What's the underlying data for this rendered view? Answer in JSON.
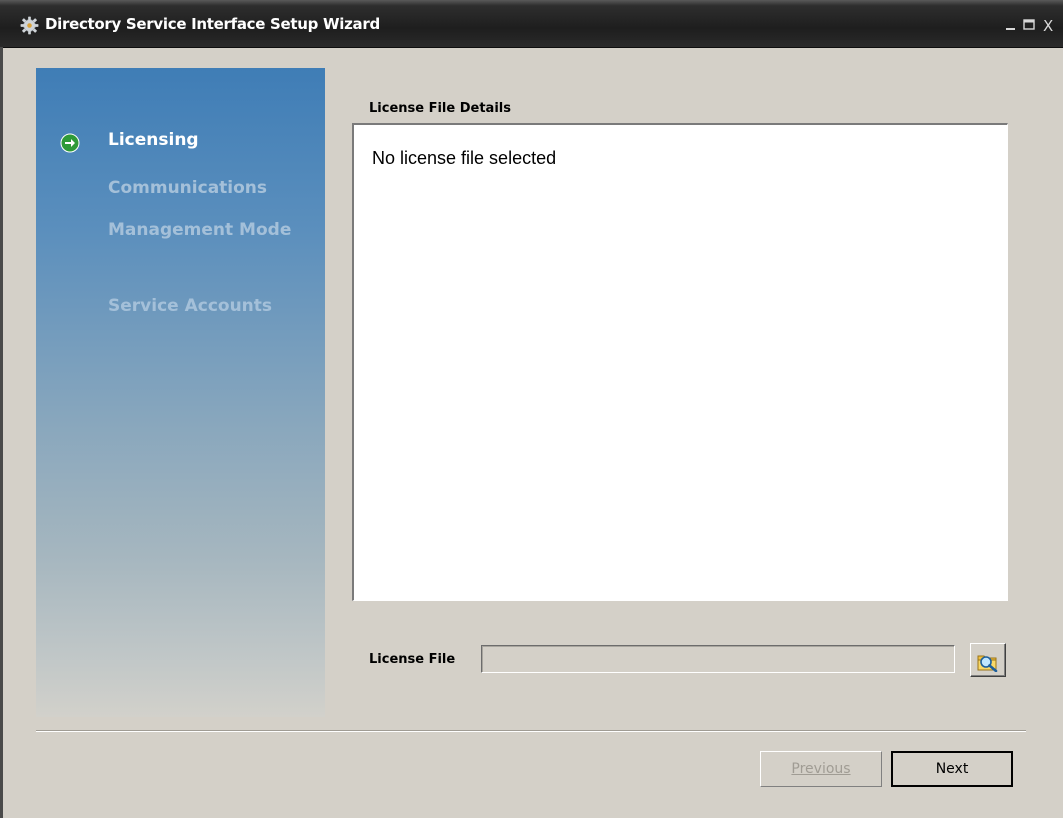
{
  "window": {
    "title": "Directory Service Interface Setup Wizard",
    "controls": [
      "minimize-icon",
      "maximize-icon",
      "close-icon"
    ],
    "close_glyph": "X"
  },
  "nav": {
    "items": [
      {
        "label": "Licensing",
        "state": "active",
        "icon": "arrow-right-circle-icon"
      },
      {
        "label": "Communications",
        "state": "inactive"
      },
      {
        "label": "Management Mode",
        "state": "inactive"
      },
      {
        "label": "Service Accounts",
        "state": "inactive"
      }
    ]
  },
  "licensing": {
    "details_label": "License File Details",
    "details_text": "No license file selected",
    "file_label": "License File",
    "file_value": "",
    "browse_icon": "browse-folder-icon"
  },
  "buttons": {
    "previous_label": "Previous",
    "next_label": "Next",
    "previous_enabled": false
  },
  "colors": {
    "nav_active": "#ffffff",
    "nav_inactive": "#a4c0d9",
    "active_step_icon": "#2e9a38",
    "dialog_bg": "#d4d0c8"
  }
}
